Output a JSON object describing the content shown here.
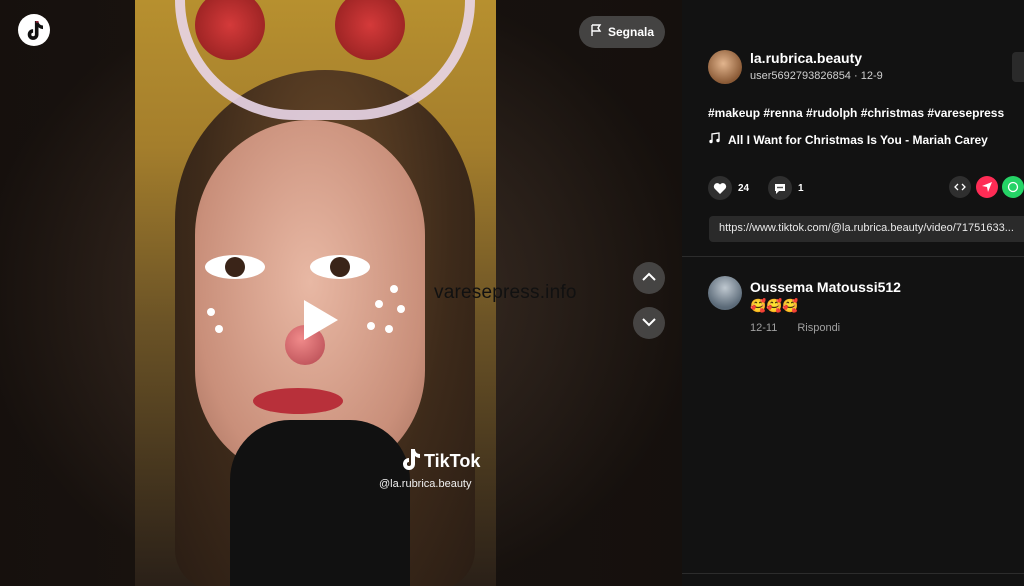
{
  "report": {
    "label": "Segnala"
  },
  "video": {
    "watermark_brand": "TikTok",
    "watermark_handle": "@la.rubrica.beauty",
    "overlay_text": "varesepress.info"
  },
  "author": {
    "username": "la.rubrica.beauty",
    "subline": "user5692793826854 · 12-9"
  },
  "caption": {
    "hashtags": "#makeup #renna #rudolph #christmas #varesepress",
    "music": "All I Want for Christmas Is You - Mariah Carey"
  },
  "stats": {
    "likes": "24",
    "comments": "1"
  },
  "link": {
    "url": "https://www.tiktok.com/@la.rubrica.beauty/video/71751633..."
  },
  "comment": {
    "name": "Oussema Matoussi512",
    "text": "🥰🥰🥰",
    "date": "12-11",
    "reply": "Rispondi"
  },
  "icons": [
    "tiktok-logo",
    "flag-icon",
    "play-icon",
    "chevron-up-icon",
    "chevron-down-icon",
    "heart-icon",
    "comment-icon",
    "embed-icon",
    "send-icon",
    "whatsapp-icon",
    "music-note-icon"
  ],
  "colors": {
    "background": "#121212",
    "panel": "#121212",
    "accent_red": "#fe2c55",
    "whatsapp": "#25d366"
  }
}
